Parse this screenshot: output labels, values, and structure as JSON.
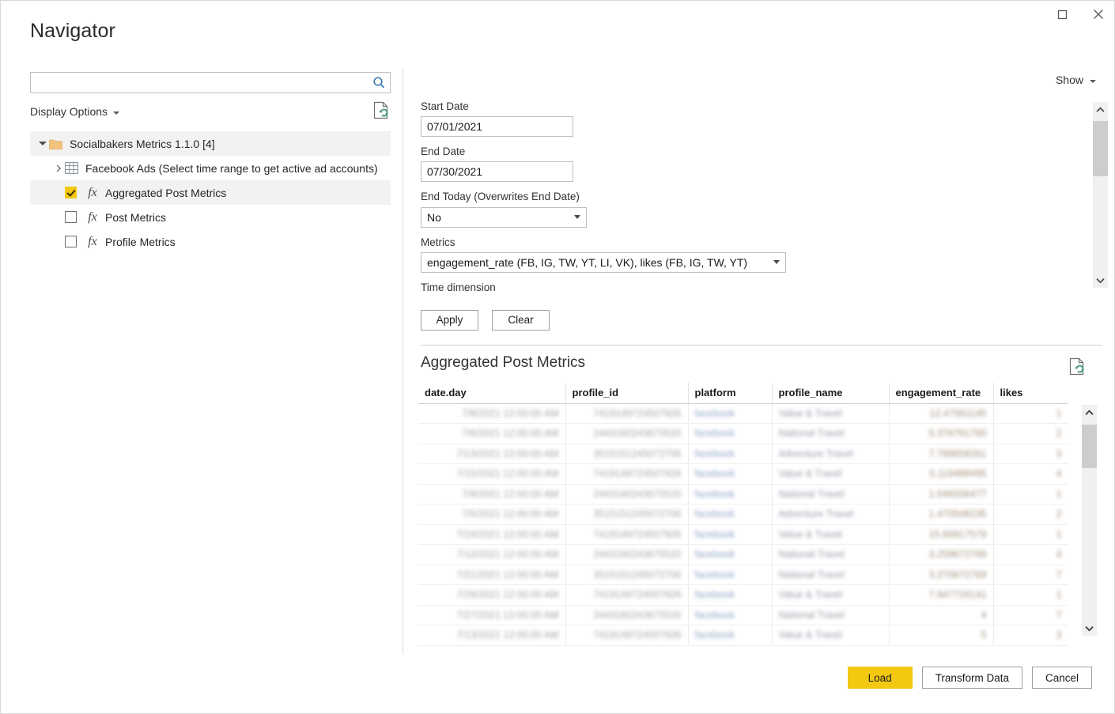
{
  "window": {
    "title": "Navigator",
    "maximize_label": "Maximize",
    "close_label": "Close"
  },
  "left_panel": {
    "search": {
      "value": "",
      "placeholder": "",
      "icon": "search-icon"
    },
    "display_options_label": "Display Options",
    "refresh_icon": "refresh-document-icon",
    "tree": [
      {
        "label": "Socialbakers Metrics 1.1.0 [4]",
        "icon": "folder-icon",
        "level": 1,
        "expanded": true,
        "has_checkbox": false,
        "checked": false,
        "selected": true
      },
      {
        "label": "Facebook Ads (Select time range to get active ad accounts)",
        "icon": "table-grid-icon",
        "level": 2,
        "expanded": false,
        "has_checkbox": false,
        "checked": false,
        "selected": false
      },
      {
        "label": "Aggregated Post Metrics",
        "icon": "fx-icon",
        "level": 2,
        "has_checkbox": true,
        "checked": true,
        "selected": true
      },
      {
        "label": "Post Metrics",
        "icon": "fx-icon",
        "level": 2,
        "has_checkbox": true,
        "checked": false,
        "selected": false
      },
      {
        "label": "Profile Metrics",
        "icon": "fx-icon",
        "level": 2,
        "has_checkbox": true,
        "checked": false,
        "selected": false
      }
    ]
  },
  "right_panel": {
    "show_label": "Show",
    "parameters": {
      "start_date": {
        "label": "Start Date",
        "value": "07/01/2021"
      },
      "end_date": {
        "label": "End Date",
        "value": "07/30/2021"
      },
      "end_today": {
        "label": "End Today (Overwrites End Date)",
        "value": "No"
      },
      "metrics": {
        "label": "Metrics",
        "value": "engagement_rate (FB, IG, TW, YT, LI, VK), likes (FB, IG, TW, YT)"
      },
      "time_dimension": {
        "label": "Time dimension",
        "value": ""
      }
    },
    "apply_label": "Apply",
    "clear_label": "Clear"
  },
  "preview": {
    "title": "Aggregated Post Metrics",
    "refresh_icon": "refresh-document-icon",
    "columns": [
      "date.day",
      "profile_id",
      "platform",
      "profile_name",
      "engagement_rate",
      "likes"
    ],
    "rows": [
      {
        "date.day": "7/8/2021 12:00:00 AM",
        "profile_id": "7419149724507926",
        "platform": "facebook",
        "profile_name": "Value & Travel",
        "engagement_rate": "12.47561145",
        "likes": "1"
      },
      {
        "date.day": "7/6/2021 12:00:00 AM",
        "profile_id": "2443160243675520",
        "platform": "facebook",
        "profile_name": "National Travel",
        "engagement_rate": "5.376761760",
        "likes": "2"
      },
      {
        "date.day": "7/13/2021 12:00:00 AM",
        "profile_id": "3515151245072706",
        "platform": "facebook",
        "profile_name": "Adventure Travel",
        "engagement_rate": "7.788858261",
        "likes": "3"
      },
      {
        "date.day": "7/15/2021 12:00:00 AM",
        "profile_id": "7419149724507926",
        "platform": "facebook",
        "profile_name": "Value & Travel",
        "engagement_rate": "5.119488495",
        "likes": "4"
      },
      {
        "date.day": "7/9/2021 12:00:00 AM",
        "profile_id": "2443160243675520",
        "platform": "facebook",
        "profile_name": "National Travel",
        "engagement_rate": "1.046506477",
        "likes": "1"
      },
      {
        "date.day": "7/5/2021 12:00:00 AM",
        "profile_id": "3515151245072706",
        "platform": "facebook",
        "profile_name": "Adventure Travel",
        "engagement_rate": "1.470508235",
        "likes": "2"
      },
      {
        "date.day": "7/19/2021 12:00:00 AM",
        "profile_id": "7419149724507926",
        "platform": "facebook",
        "profile_name": "Value & Travel",
        "engagement_rate": "15.60917579",
        "likes": "1"
      },
      {
        "date.day": "7/12/2021 12:00:00 AM",
        "profile_id": "2443160243675520",
        "platform": "facebook",
        "profile_name": "National Travel",
        "engagement_rate": "3.259672769",
        "likes": "4"
      },
      {
        "date.day": "7/21/2021 12:00:00 AM",
        "profile_id": "3515151245072706",
        "platform": "facebook",
        "profile_name": "National Travel",
        "engagement_rate": "3.270672769",
        "likes": "7"
      },
      {
        "date.day": "7/29/2021 12:00:00 AM",
        "profile_id": "7419149724507926",
        "platform": "facebook",
        "profile_name": "Value & Travel",
        "engagement_rate": "7.947724141",
        "likes": "1"
      },
      {
        "date.day": "7/27/2021 12:00:00 AM",
        "profile_id": "2443160243675520",
        "platform": "facebook",
        "profile_name": "National Travel",
        "engagement_rate": "4",
        "likes": "7"
      },
      {
        "date.day": "7/13/2021 12:00:00 AM",
        "profile_id": "7419149724507926",
        "platform": "facebook",
        "profile_name": "Value & Travel",
        "engagement_rate": "5",
        "likes": "3"
      }
    ]
  },
  "footer": {
    "load_label": "Load",
    "transform_label": "Transform Data",
    "cancel_label": "Cancel"
  },
  "colors": {
    "accent_gold": "#F2C811",
    "search_icon_blue": "#3573B0",
    "refresh_green": "#4E9A83",
    "folder_gold": "#F2C27E"
  }
}
